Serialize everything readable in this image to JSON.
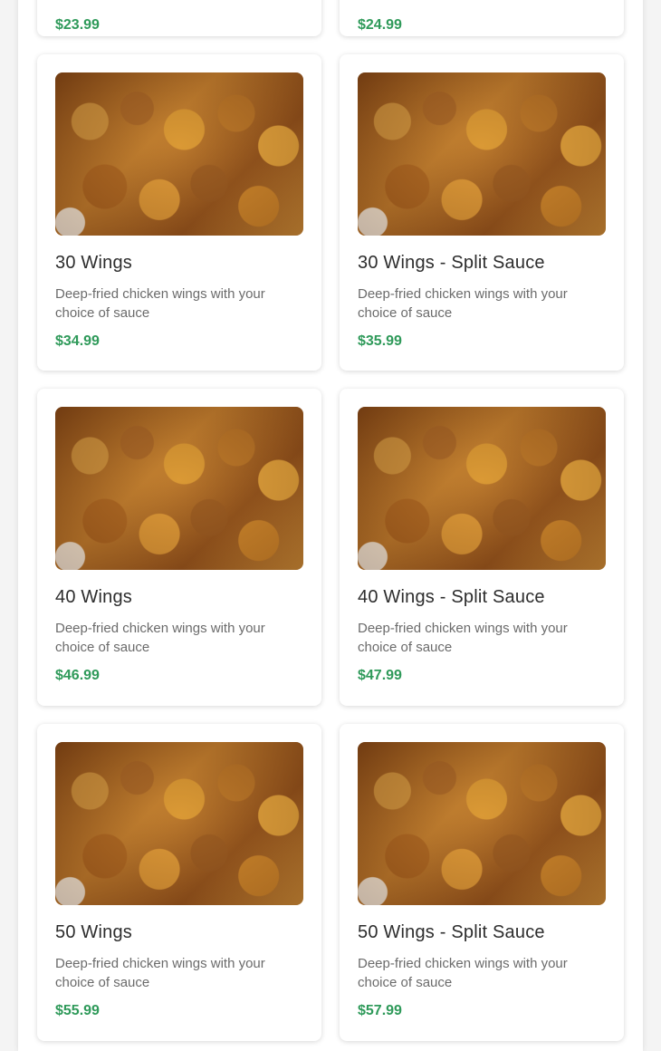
{
  "menu": {
    "items": [
      {
        "title": "",
        "description": "",
        "price": "$23.99"
      },
      {
        "title": "",
        "description": "",
        "price": "$24.99"
      },
      {
        "title": "30 Wings",
        "description": "Deep-fried chicken wings with your choice of sauce",
        "price": "$34.99"
      },
      {
        "title": "30 Wings - Split Sauce",
        "description": "Deep-fried chicken wings with your choice of sauce",
        "price": "$35.99"
      },
      {
        "title": "40 Wings",
        "description": "Deep-fried chicken wings with your choice of sauce",
        "price": "$46.99"
      },
      {
        "title": "40 Wings - Split Sauce",
        "description": "Deep-fried chicken wings with your choice of sauce",
        "price": "$47.99"
      },
      {
        "title": "50 Wings",
        "description": "Deep-fried chicken wings with your choice of sauce",
        "price": "$55.99"
      },
      {
        "title": "50 Wings - Split Sauce",
        "description": "Deep-fried chicken wings with your choice of sauce",
        "price": "$57.99"
      }
    ]
  }
}
